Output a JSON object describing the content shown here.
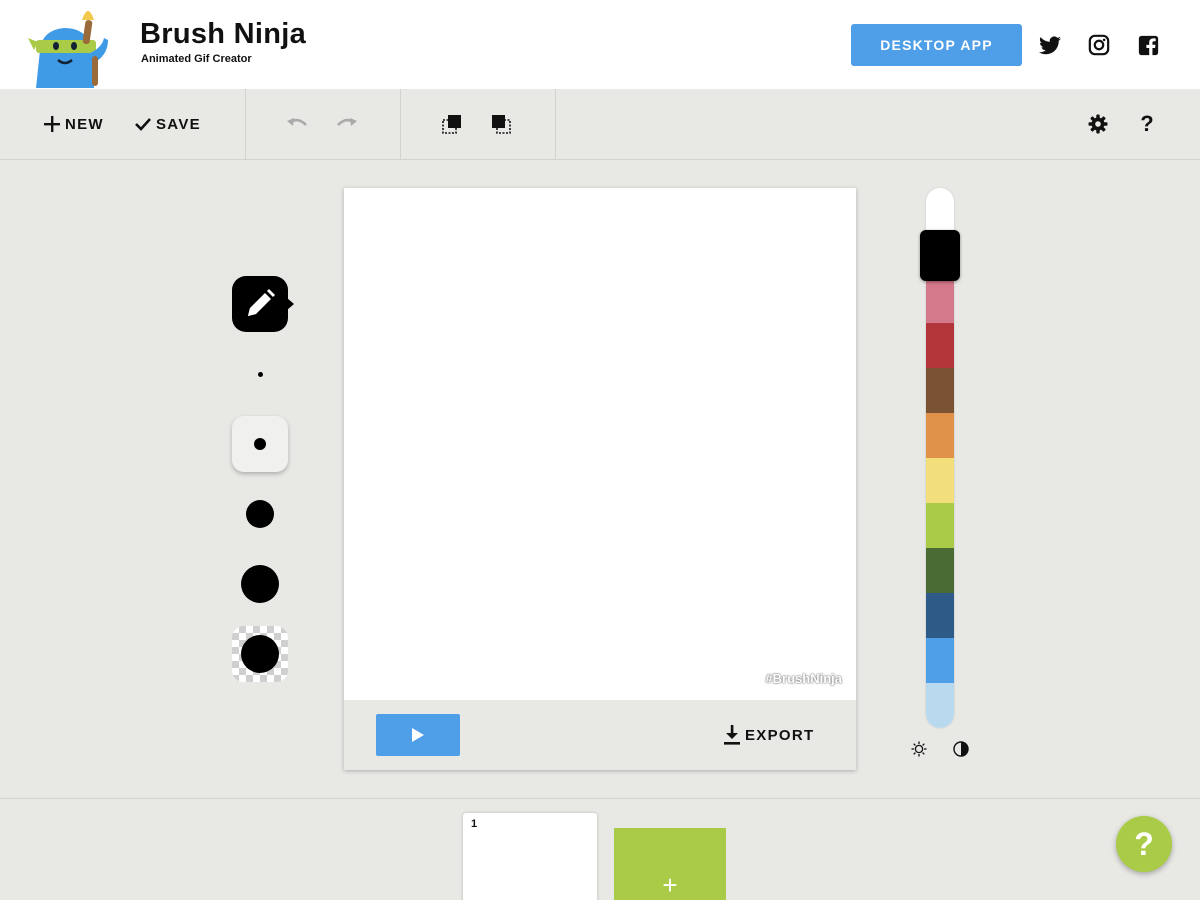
{
  "header": {
    "logo_icon": "ninja-mascot-icon",
    "title": "Brush Ninja",
    "subtitle": "Animated Gif Creator",
    "desktop_app_label": "DESKTOP APP",
    "social": [
      "twitter-icon",
      "instagram-icon",
      "facebook-icon"
    ]
  },
  "toolbar": {
    "new_label": "NEW",
    "save_label": "SAVE",
    "undo_icon": "undo-icon",
    "redo_icon": "redo-icon",
    "copy_frame_icon": "duplicate-frame-icon",
    "onion_skin_icon": "onion-skin-icon",
    "settings_icon": "gear-icon",
    "help_icon": "question-icon"
  },
  "brush_tools": {
    "active_tool": "pencil-icon",
    "sizes": [
      "extra-small",
      "small",
      "medium",
      "large",
      "extra-large"
    ],
    "selected_size": "small",
    "eraser_size": "extra-large"
  },
  "canvas": {
    "watermark": "#BrushNinja",
    "play_icon": "play-icon",
    "export_label": "EXPORT"
  },
  "palette": {
    "colors": [
      "#ffffff",
      "#000000",
      "#d4788c",
      "#b3373a",
      "#7a5432",
      "#e0924a",
      "#f2df7b",
      "#a9cb48",
      "#4a6b33",
      "#2e5a88",
      "#4f9ee8",
      "#b8d9ee"
    ],
    "selected": "#000000",
    "lighten_icon": "sun-icon",
    "darken_icon": "contrast-icon"
  },
  "timeline": {
    "frames": [
      "1"
    ],
    "add_frame_label": "+"
  },
  "help_fab_label": "?"
}
